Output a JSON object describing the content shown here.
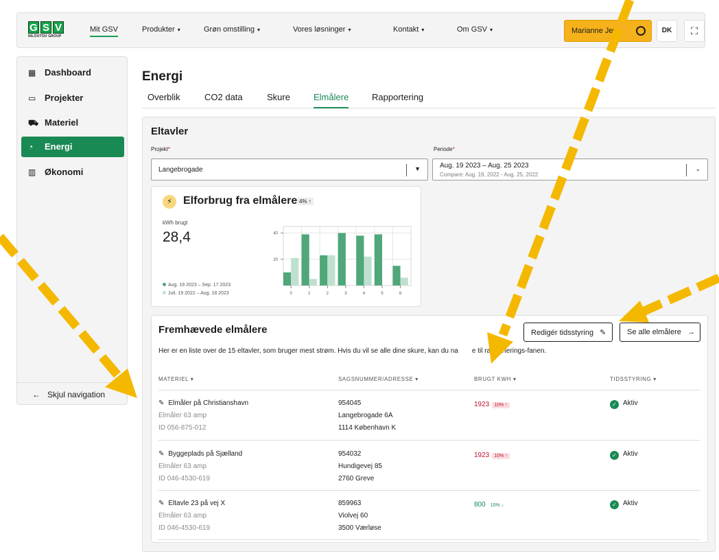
{
  "brand": {
    "logo_text": "GSV",
    "logo_sub": "NILOUTOU GROUP"
  },
  "topnav": {
    "items": [
      {
        "label": "Mit GSV"
      },
      {
        "label": "Produkter"
      },
      {
        "label": "Grøn omstilling"
      },
      {
        "label": "Vores løsninger"
      },
      {
        "label": "Kontakt"
      },
      {
        "label": "Om GSV"
      }
    ],
    "caret": "▾",
    "user_label": "Marianne Jen",
    "user_label_tail": "n",
    "lang": "DK",
    "cart_icon": "🛒"
  },
  "sidebar": {
    "items": [
      {
        "icon": "▦",
        "label": "Dashboard"
      },
      {
        "icon": "▭",
        "label": "Projekter"
      },
      {
        "icon": "⛟",
        "label": "Materiel"
      },
      {
        "icon": "◔",
        "label": "Energi"
      },
      {
        "icon": "▥",
        "label": "Økonomi"
      }
    ],
    "hide_label": "Skjul navigation",
    "hide_arrow": "←"
  },
  "page": {
    "title": "Energi",
    "tabs": [
      {
        "label": "Overblik"
      },
      {
        "label": "CO2 data"
      },
      {
        "label": "Skure"
      },
      {
        "label": "Elmålere"
      },
      {
        "label": "Rapportering"
      }
    ]
  },
  "panel": {
    "title": "Eltavler",
    "project_label": "Projekt",
    "project_value": "Langebrogade",
    "period_label": "Periode",
    "period_value": "Aug. 19 2023 – Aug. 25 2023",
    "period_compare": "Compare: Aug. 19, 2022 - Aug. 25, 2022",
    "required_mark": "*",
    "chevron": "⌄"
  },
  "chart_card": {
    "icon": "⚡",
    "title": "Elforbrug fra elmålere",
    "badge": "4% ↑",
    "kwh_label": "kWh brugt",
    "kwh_value": "28,4",
    "legend_current": "Aug. 19 2023 – Sep. 17 2023",
    "legend_previous": "Juli. 19 2022 – Aug. 18 2023"
  },
  "chart_data": {
    "type": "bar",
    "categories": [
      "0",
      "1",
      "2",
      "3",
      "4",
      "5",
      "6"
    ],
    "series": [
      {
        "name": "Aug. 19 2023 – Sep. 17 2023",
        "values": [
          10,
          39,
          23,
          40,
          38,
          39,
          15
        ],
        "color": "#4fa77a"
      },
      {
        "name": "Juli. 19 2022 – Aug. 18 2023",
        "values": [
          21,
          5,
          23,
          0,
          22,
          0,
          6
        ],
        "color": "#bfe0cf"
      }
    ],
    "y_ticks": [
      "40",
      "20"
    ],
    "ylim": [
      0,
      45
    ],
    "grid": true
  },
  "featured": {
    "title": "Fremhævede elmålere",
    "edit_button": "Redigér tidsstyring",
    "edit_icon": "✎",
    "all_button": "Se alle elmålere",
    "all_icon": "→",
    "description": "Her er en liste over de 15 eltavler, som bruger mest strøm. Hvis du vil se alle dine skure, kan du na",
    "description_tail": "e til rapporterings-fanen.",
    "columns": [
      {
        "label": "MATERIEL ▾"
      },
      {
        "label": "SAGSNUMMER/ADRESSE ▾"
      },
      {
        "label": "BRUGT KWH ▾"
      },
      {
        "label": "TIDSSTYRING ▾"
      }
    ],
    "rows": [
      {
        "name": "Elmåler på Christianshavn",
        "type": "Elmåler 63 amp",
        "id": "ID 056-875-012",
        "case": "954045",
        "street": "Langebrogade 6A",
        "city": "1114 København K",
        "kwh": "1923",
        "pct": "10% ↑",
        "status": "Aktiv"
      },
      {
        "name": "Byggeplads på Sjælland",
        "type": "Elmåler 63 amp",
        "id": "ID 046-4530-619",
        "case": "954032",
        "street": "Hundigevej 85",
        "city": "2760 Greve",
        "kwh": "1923",
        "pct": "10% ↑",
        "status": "Aktiv"
      },
      {
        "name": "Eltavle 23 på vej X",
        "type": "Elmåler 63 amp",
        "id": "ID 046-4530-619",
        "case": "859963",
        "street": "Violvej 60",
        "city": "3500 Værløse",
        "kwh": "800",
        "pct": "10% ↓",
        "status": "Aktiv"
      }
    ],
    "edit_row_icon": "✎",
    "check_icon": "✓"
  },
  "colors": {
    "accent": "#1a8a55",
    "warning": "#f6b21b",
    "red": "#c0142a",
    "arrow": "#f5b800"
  }
}
